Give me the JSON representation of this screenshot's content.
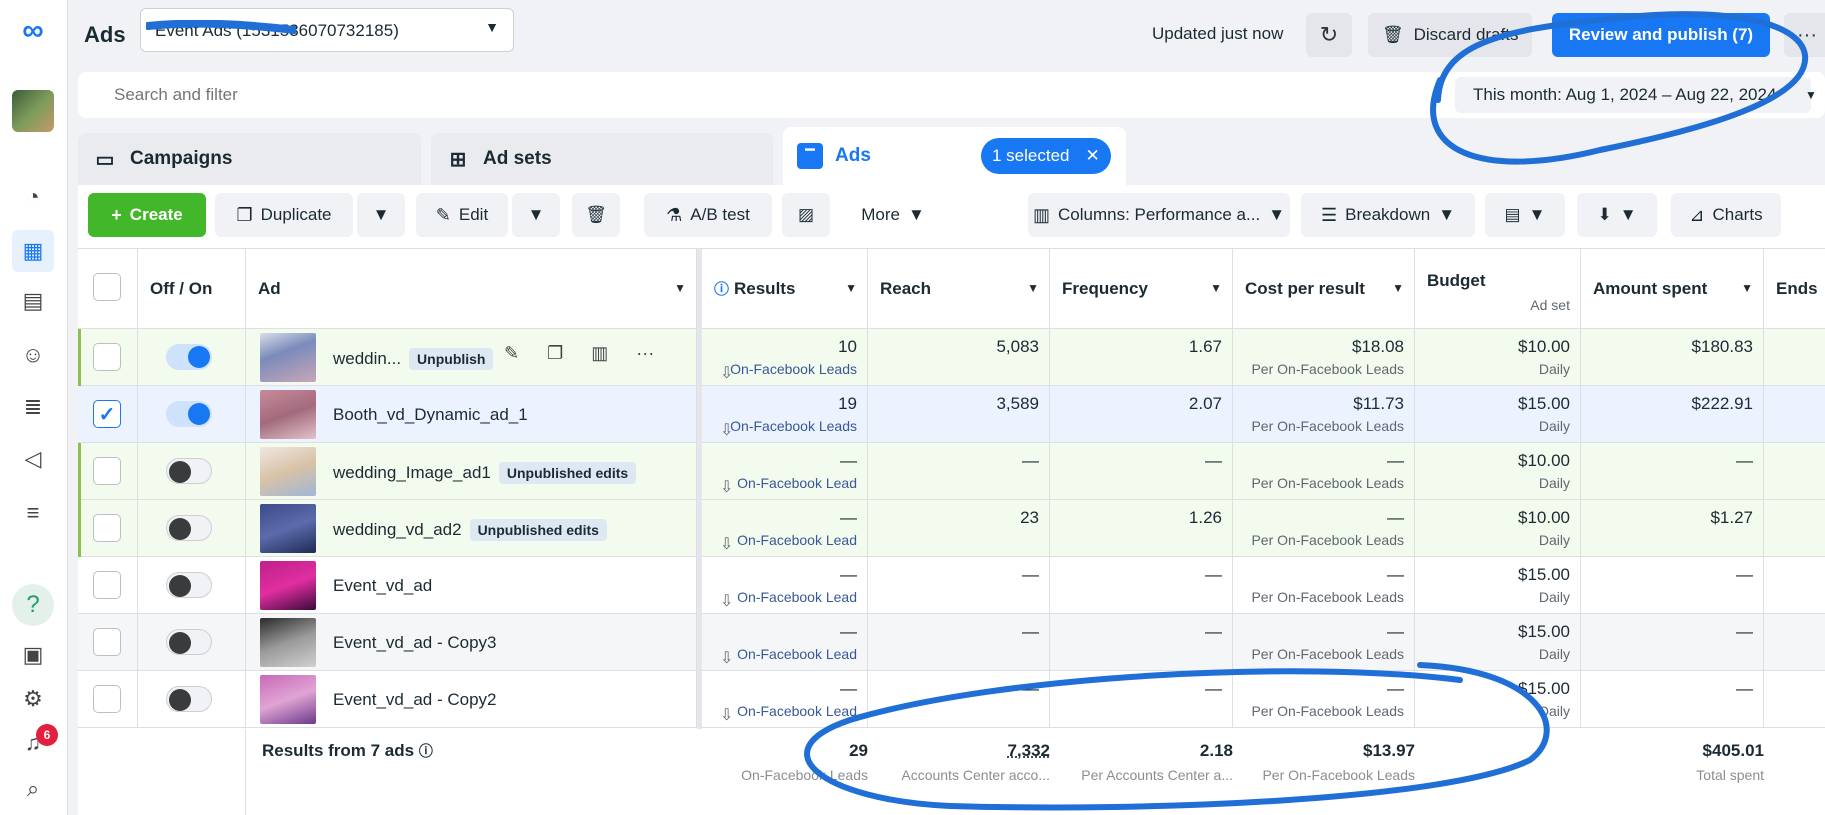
{
  "header": {
    "title": "Ads",
    "account_select": "Event Ads (1531536070732185)",
    "updated": "Updated just now",
    "discard": "Discard drafts",
    "publish": "Review and publish (7)"
  },
  "search": {
    "placeholder": "Search and filter"
  },
  "date_range": "This month: Aug 1, 2024 – Aug 22, 2024",
  "tabs": [
    {
      "label": "Campaigns"
    },
    {
      "label": "Ad sets"
    },
    {
      "label": "Ads"
    }
  ],
  "selected_pill": "1 selected",
  "toolbar": {
    "create": "Create",
    "duplicate": "Duplicate",
    "edit": "Edit",
    "ab_test": "A/B test",
    "more": "More",
    "columns": "Columns: Performance a...",
    "breakdown": "Breakdown",
    "charts": "Charts"
  },
  "columns": {
    "off_on": "Off / On",
    "ad": "Ad",
    "results": "Results",
    "reach": "Reach",
    "frequency": "Frequency",
    "cost_per_result": "Cost per result",
    "budget": "Budget",
    "budget_sub": "Ad set",
    "amount_spent": "Amount spent",
    "ends": "Ends"
  },
  "rows": [
    {
      "name": "weddin...",
      "badge": "Unpublish",
      "on": true,
      "checked": false,
      "results": "10",
      "results_label": "On-Facebook Leads",
      "reach": "5,083",
      "frequency": "1.67",
      "cpr": "$18.08",
      "cpr_label": "Per On-Facebook Leads",
      "budget": "$10.00",
      "budget_label": "Daily",
      "spent": "$180.83"
    },
    {
      "name": "Booth_vd_Dynamic_ad_1",
      "badge": "",
      "on": true,
      "checked": true,
      "results": "19",
      "results_label": "On-Facebook Leads",
      "reach": "3,589",
      "frequency": "2.07",
      "cpr": "$11.73",
      "cpr_label": "Per On-Facebook Leads",
      "budget": "$15.00",
      "budget_label": "Daily",
      "spent": "$222.91"
    },
    {
      "name": "wedding_Image_ad1",
      "badge": "Unpublished edits",
      "on": false,
      "checked": false,
      "results": "—",
      "results_label": "On-Facebook Lead",
      "reach": "—",
      "frequency": "—",
      "cpr": "—",
      "cpr_label": "Per On-Facebook Leads",
      "budget": "$10.00",
      "budget_label": "Daily",
      "spent": "—"
    },
    {
      "name": "wedding_vd_ad2",
      "badge": "Unpublished edits",
      "on": false,
      "checked": false,
      "results": "—",
      "results_label": "On-Facebook Lead",
      "reach": "23",
      "frequency": "1.26",
      "cpr": "—",
      "cpr_label": "Per On-Facebook Leads",
      "budget": "$10.00",
      "budget_label": "Daily",
      "spent": "$1.27"
    },
    {
      "name": "Event_vd_ad",
      "badge": "",
      "on": false,
      "checked": false,
      "results": "—",
      "results_label": "On-Facebook Lead",
      "reach": "—",
      "frequency": "—",
      "cpr": "—",
      "cpr_label": "Per On-Facebook Leads",
      "budget": "$15.00",
      "budget_label": "Daily",
      "spent": "—"
    },
    {
      "name": "Event_vd_ad - Copy3",
      "badge": "",
      "on": false,
      "checked": false,
      "results": "—",
      "results_label": "On-Facebook Lead",
      "reach": "—",
      "frequency": "—",
      "cpr": "—",
      "cpr_label": "Per On-Facebook Leads",
      "budget": "$15.00",
      "budget_label": "Daily",
      "spent": "—"
    },
    {
      "name": "Event_vd_ad - Copy2",
      "badge": "",
      "on": false,
      "checked": false,
      "results": "—",
      "results_label": "On-Facebook Lead",
      "reach": "—",
      "frequency": "—",
      "cpr": "—",
      "cpr_label": "Per On-Facebook Leads",
      "budget": "$15.00",
      "budget_label": "Daily",
      "spent": "—"
    }
  ],
  "footer": {
    "title": "Results from 7 ads",
    "results": "29",
    "results_label": "On-Facebook Leads",
    "reach": "7,332",
    "reach_label": "Accounts Center acco...",
    "frequency": "2.18",
    "frequency_label": "Per Accounts Center a...",
    "cpr": "$13.97",
    "cpr_label": "Per On-Facebook Leads",
    "spent": "$405.01",
    "spent_label": "Total spent"
  },
  "notifications_count": "6",
  "colors": {
    "accent": "#1877f2",
    "create": "#42b72a",
    "annotation": "#1f6fd6"
  }
}
